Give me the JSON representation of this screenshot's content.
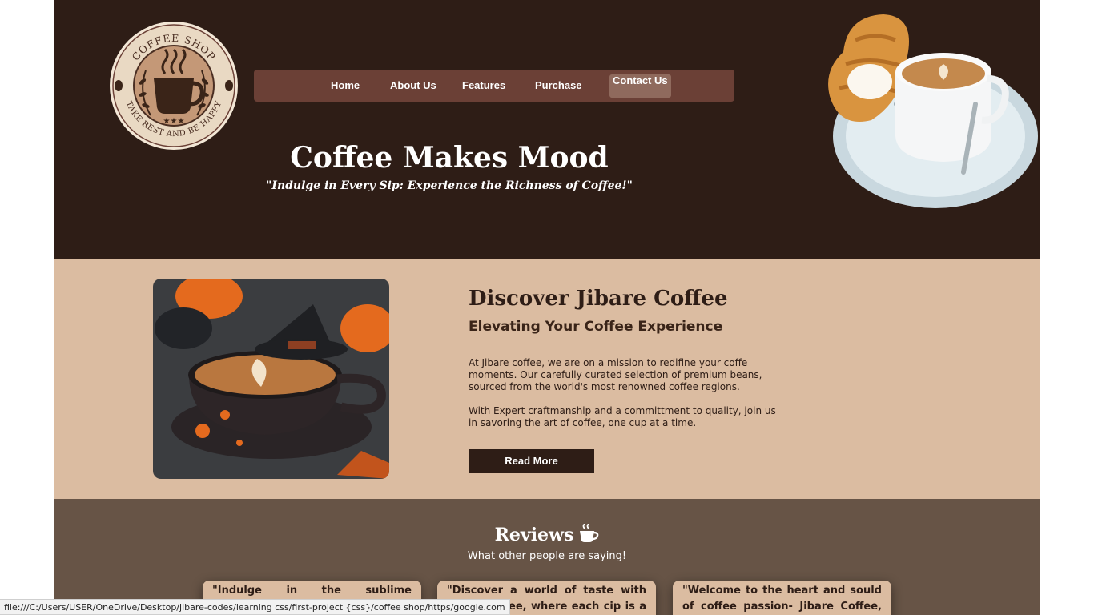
{
  "logo": {
    "top_text": "COFFEE SHOP",
    "bottom_text": "TAKE REST AND BE HAPPY",
    "stars": "★★★"
  },
  "nav": {
    "items": [
      {
        "label": "Home"
      },
      {
        "label": "About Us"
      },
      {
        "label": "Features"
      },
      {
        "label": "Purchase"
      },
      {
        "label": "Contact Us"
      }
    ]
  },
  "hero": {
    "title": "Coffee Makes Mood",
    "subtitle": "\"Indulge in Every Sip: Experience the Richness of Coffee!\""
  },
  "discover": {
    "title": "Discover Jibare Coffee",
    "subtitle": "Elevating Your Coffee Experience",
    "paragraph1": "At Jibare coffee, we are on a mission to redifine your coffe moments. Our carefully curated selection of premium beans, sourced from the world's most renowned coffee regions.",
    "paragraph2": "With Expert craftmanship and a committment to quality, join us in savoring the art of coffee, one cup at a time.",
    "button": "Read More"
  },
  "reviews": {
    "title": "Reviews",
    "subtitle": "What other people are saying!",
    "cards": [
      {
        "text": "\"Indulge in the sublime experience of"
      },
      {
        "text": "\"Discover a world of taste with Jibare Coffee, where each cip is a masterpiece,"
      },
      {
        "text": "\"Welcome to the heart and sould of coffee passion- Jibare Coffee, Our"
      }
    ]
  },
  "statusbar": {
    "url": "file:///C:/Users/USER/OneDrive/Desktop/jibare-codes/learning css/first-project {css}/coffee shop/https/google.com"
  },
  "colors": {
    "hero_bg": "#2e1d16",
    "nav_bg": "#6b4036",
    "discover_bg": "#dbbca1",
    "reviews_bg": "#675446"
  }
}
